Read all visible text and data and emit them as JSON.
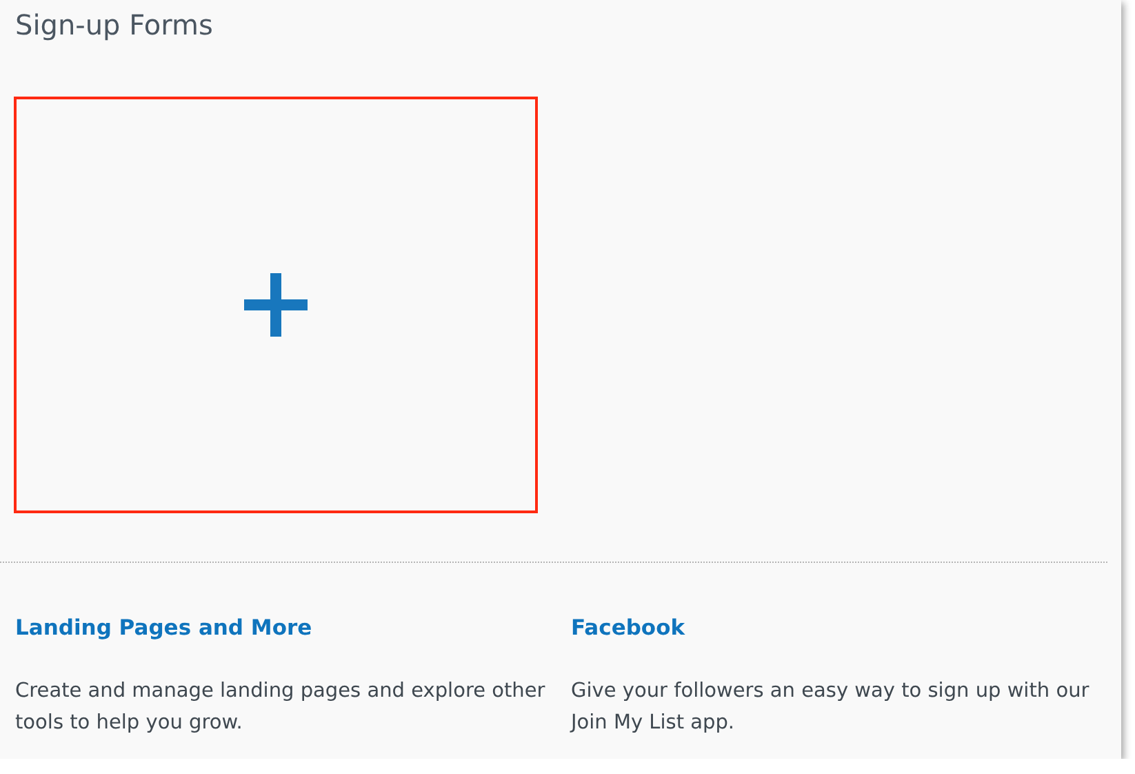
{
  "title": "Sign-up Forms",
  "add_tile": {
    "highlighted": true
  },
  "links": [
    {
      "title": "Landing Pages and More",
      "description": "Create and manage landing pages and explore other tools to help you grow."
    },
    {
      "title": "Facebook",
      "description": "Give your followers an easy way to sign up with our Join My List app."
    }
  ]
}
